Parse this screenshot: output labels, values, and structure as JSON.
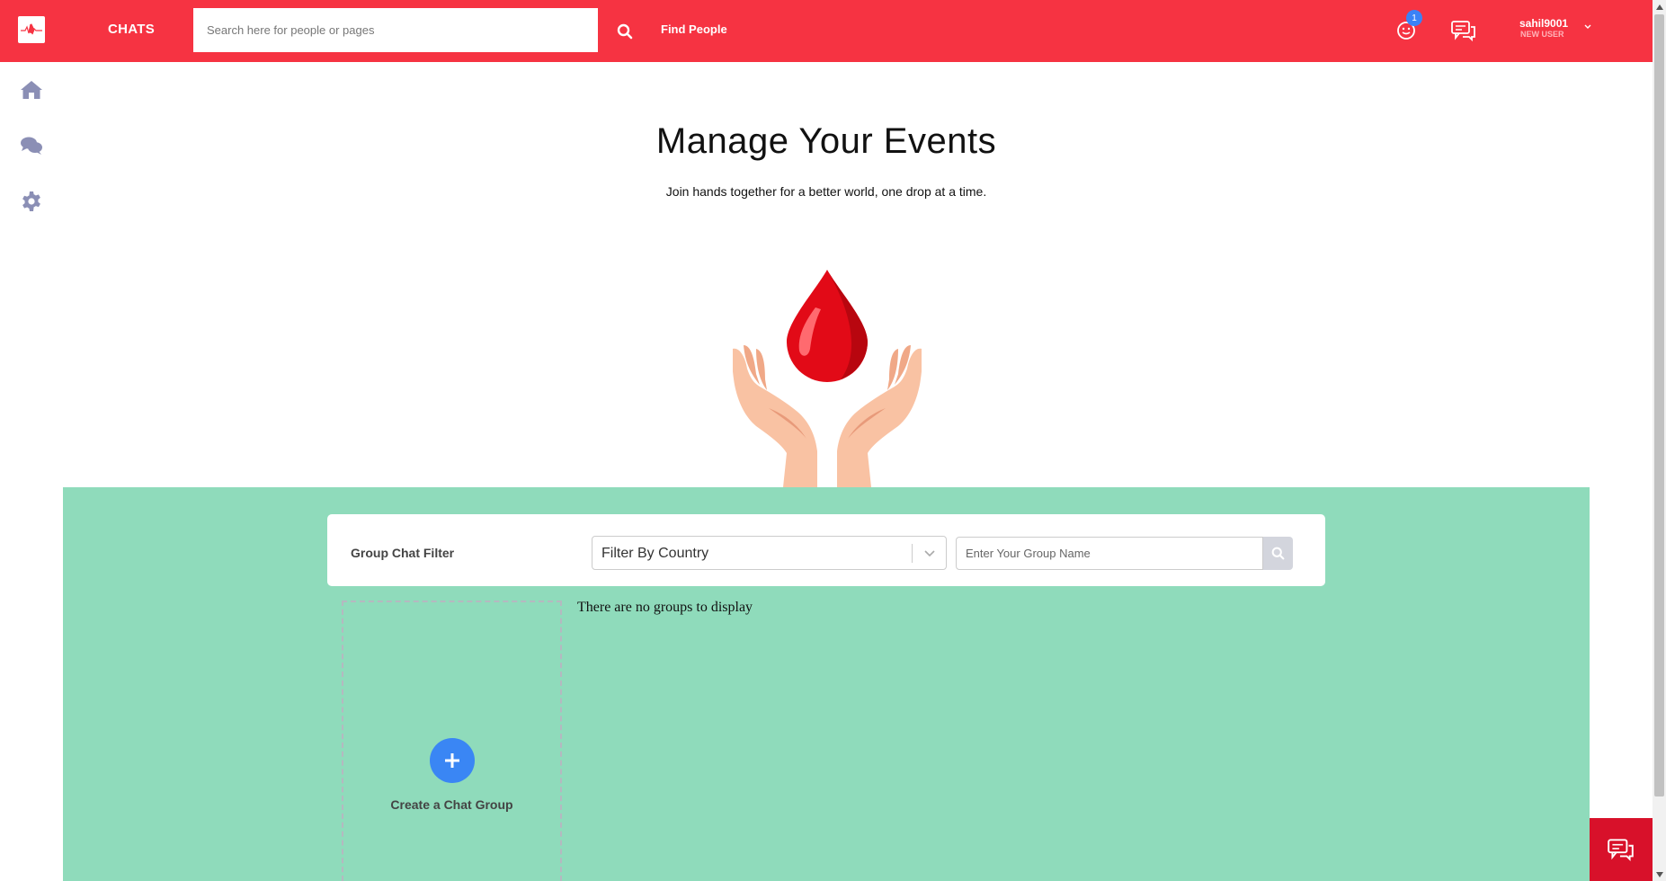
{
  "header": {
    "brand_title": "CHATS",
    "search_placeholder": "Search here for people or pages",
    "find_people_label": "Find People",
    "notification_count": "1",
    "user_name": "sahil9001",
    "user_role": "NEW USER"
  },
  "sidebar": {
    "items": [
      {
        "icon": "home-icon"
      },
      {
        "icon": "chat-bubbles-icon"
      },
      {
        "icon": "gear-icon"
      }
    ]
  },
  "hero": {
    "title": "Manage Your Events",
    "subtitle": "Join hands together for a better world, one drop at a time."
  },
  "filter": {
    "label": "Group Chat Filter",
    "country_selected": "Filter By Country",
    "group_name_placeholder": "Enter Your Group Name"
  },
  "groups": {
    "create_label": "Create a Chat Group",
    "empty_message": "There are no groups to display"
  },
  "colors": {
    "header_bg": "#f63342",
    "accent_green": "#8fdbbb",
    "primary_blue": "#3a86f4",
    "floating_button": "#d8112a",
    "sidebar_icon": "#8b8fb5"
  }
}
